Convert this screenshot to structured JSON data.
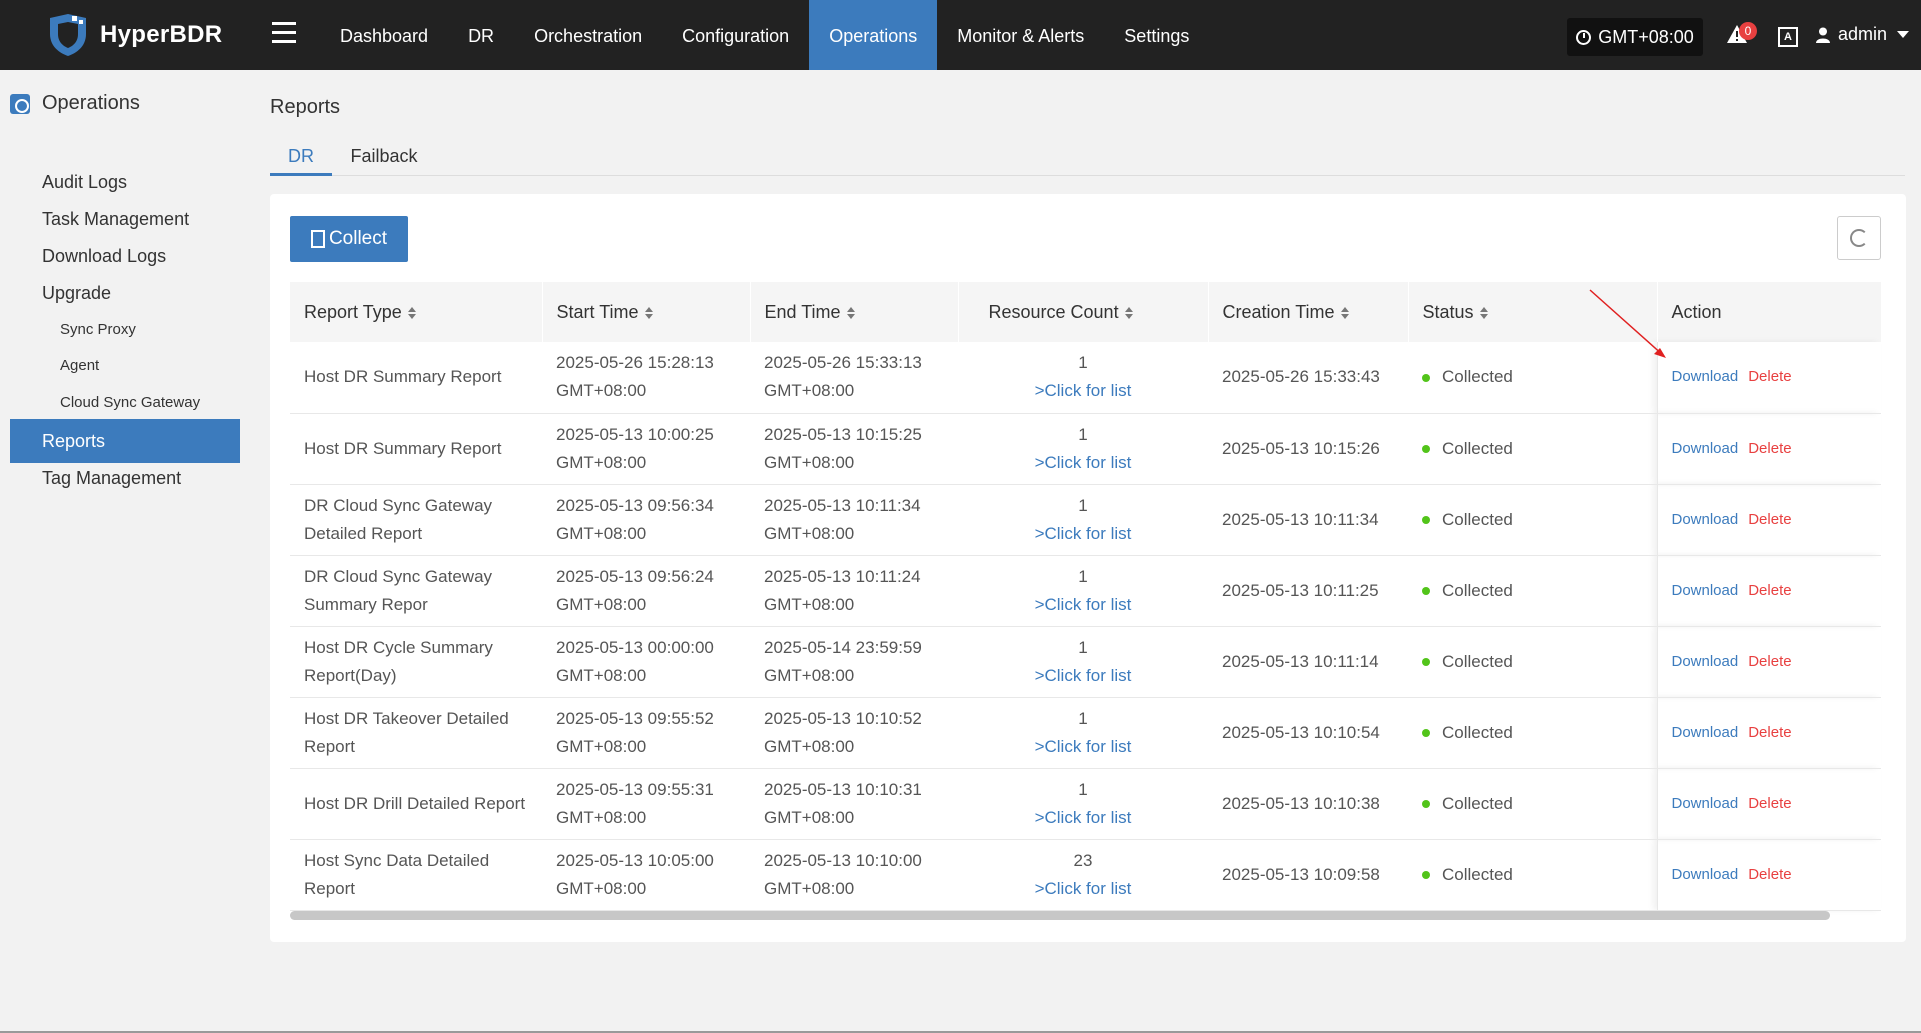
{
  "app": {
    "name": "HyperBDR"
  },
  "nav": {
    "items": [
      "Dashboard",
      "DR",
      "Orchestration",
      "Configuration",
      "Operations",
      "Monitor & Alerts",
      "Settings"
    ],
    "active_index": 4
  },
  "header": {
    "timezone": "GMT+08:00",
    "alert_count": "0",
    "lang_label": "A",
    "user": "admin"
  },
  "sidebar": {
    "section": "Operations",
    "items": [
      {
        "label": "Audit Logs",
        "level": 1
      },
      {
        "label": "Task Management",
        "level": 1
      },
      {
        "label": "Download Logs",
        "level": 1
      },
      {
        "label": "Upgrade",
        "level": 1
      },
      {
        "label": "Sync Proxy",
        "level": 2
      },
      {
        "label": "Agent",
        "level": 2
      },
      {
        "label": "Cloud Sync Gateway",
        "level": 2
      },
      {
        "label": "Reports",
        "level": 1
      },
      {
        "label": "Tag Management",
        "level": 1
      }
    ],
    "active_index": 7
  },
  "page": {
    "title": "Reports"
  },
  "tabs": {
    "items": [
      "DR",
      "Failback"
    ],
    "active_index": 0
  },
  "toolbar": {
    "collect_label": "Collect"
  },
  "table": {
    "columns": [
      "Report Type",
      "Start Time",
      "End Time",
      "Resource Count",
      "Creation Time",
      "Status",
      "Action"
    ],
    "rows": [
      {
        "type": "Host DR Summary Report",
        "start": "2025-05-26 15:28:13",
        "start_tz": "GMT+08:00",
        "end": "2025-05-26 15:33:13",
        "end_tz": "GMT+08:00",
        "count": "1",
        "count_link": ">Click for list",
        "created": "2025-05-26 15:33:43",
        "status": "Collected",
        "download": "Download",
        "delete": "Delete"
      },
      {
        "type": "Host DR Summary Report",
        "start": "2025-05-13 10:00:25",
        "start_tz": "GMT+08:00",
        "end": "2025-05-13 10:15:25",
        "end_tz": "GMT+08:00",
        "count": "1",
        "count_link": ">Click for list",
        "created": "2025-05-13 10:15:26",
        "status": "Collected",
        "download": "Download",
        "delete": "Delete"
      },
      {
        "type": "DR Cloud Sync Gateway Detailed Report",
        "start": "2025-05-13 09:56:34",
        "start_tz": "GMT+08:00",
        "end": "2025-05-13 10:11:34",
        "end_tz": "GMT+08:00",
        "count": "1",
        "count_link": ">Click for list",
        "created": "2025-05-13 10:11:34",
        "status": "Collected",
        "download": "Download",
        "delete": "Delete"
      },
      {
        "type": "DR Cloud Sync Gateway Summary Repor",
        "start": "2025-05-13 09:56:24",
        "start_tz": "GMT+08:00",
        "end": "2025-05-13 10:11:24",
        "end_tz": "GMT+08:00",
        "count": "1",
        "count_link": ">Click for list",
        "created": "2025-05-13 10:11:25",
        "status": "Collected",
        "download": "Download",
        "delete": "Delete"
      },
      {
        "type": "Host DR Cycle Summary Report(Day)",
        "start": "2025-05-13 00:00:00",
        "start_tz": "GMT+08:00",
        "end": "2025-05-14 23:59:59",
        "end_tz": "GMT+08:00",
        "count": "1",
        "count_link": ">Click for list",
        "created": "2025-05-13 10:11:14",
        "status": "Collected",
        "download": "Download",
        "delete": "Delete"
      },
      {
        "type": "Host DR Takeover Detailed Report",
        "start": "2025-05-13 09:55:52",
        "start_tz": "GMT+08:00",
        "end": "2025-05-13 10:10:52",
        "end_tz": "GMT+08:00",
        "count": "1",
        "count_link": ">Click for list",
        "created": "2025-05-13 10:10:54",
        "status": "Collected",
        "download": "Download",
        "delete": "Delete"
      },
      {
        "type": "Host DR Drill Detailed Report",
        "start": "2025-05-13 09:55:31",
        "start_tz": "GMT+08:00",
        "end": "2025-05-13 10:10:31",
        "end_tz": "GMT+08:00",
        "count": "1",
        "count_link": ">Click for list",
        "created": "2025-05-13 10:10:38",
        "status": "Collected",
        "download": "Download",
        "delete": "Delete"
      },
      {
        "type": "Host Sync Data Detailed Report",
        "start": "2025-05-13 10:05:00",
        "start_tz": "GMT+08:00",
        "end": "2025-05-13 10:10:00",
        "end_tz": "GMT+08:00",
        "count": "23",
        "count_link": ">Click for list",
        "created": "2025-05-13 10:09:58",
        "status": "Collected",
        "download": "Download",
        "delete": "Delete"
      }
    ]
  },
  "colors": {
    "topbar": "#222222",
    "accent": "#3c7bbd",
    "status_ok": "#52c41a",
    "danger": "#e84040",
    "annotation_arrow": "#e02020"
  }
}
